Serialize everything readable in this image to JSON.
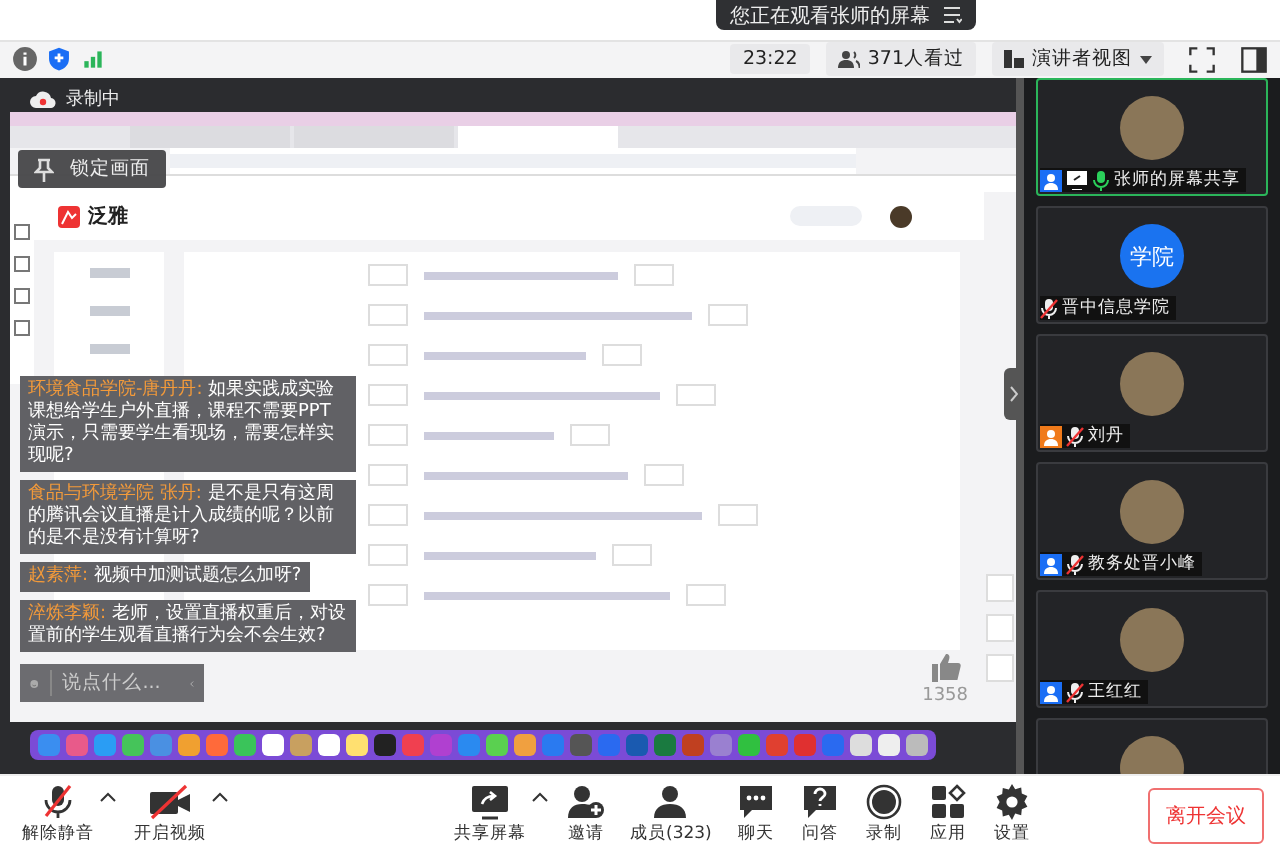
{
  "toast": {
    "text": "您正在观看张师的屏幕"
  },
  "status_bar": {
    "time": "23:22",
    "viewers": "371人看过",
    "view_mode": "演讲者视图"
  },
  "recording": {
    "label": "录制中"
  },
  "lock_button": {
    "label": "锁定画面"
  },
  "shared_screen": {
    "app_name": "泛雅",
    "likes": "1358"
  },
  "chat": {
    "messages": [
      {
        "sender": "环境食品学院-唐丹丹:",
        "text": "如果实践成实验课想给学生户外直播，课程不需要PPT演示，只需要学生看现场，需要怎样实现呢?"
      },
      {
        "sender": "食品与环境学院 张丹:",
        "text": "是不是只有这周的腾讯会议直播是计入成绩的呢？以前的是不是没有计算呀?"
      },
      {
        "sender": "赵素萍:",
        "text": "视频中加测试题怎么加呀?"
      },
      {
        "sender": "淬炼李颖:",
        "text": "老师，设置直播权重后，对设置前的学生观看直播行为会不会生效?"
      }
    ],
    "placeholder": "说点什么..."
  },
  "participants": [
    {
      "name": "张师的屏幕共享",
      "color": "#1a6ef5",
      "sharing": true,
      "muted": false,
      "active": true
    },
    {
      "name": "晋中信息学院",
      "avatar_text": "学院",
      "sharing": false,
      "muted": true,
      "active": false
    },
    {
      "name": "刘丹",
      "color": "#f07a1a",
      "sharing": false,
      "muted": true,
      "active": false
    },
    {
      "name": "教务处晋小峰",
      "color": "#1a6ef5",
      "sharing": false,
      "muted": true,
      "active": false
    },
    {
      "name": "王红红",
      "color": "#1a6ef5",
      "sharing": false,
      "muted": true,
      "active": false
    }
  ],
  "toolbar": [
    {
      "kind": "mic",
      "label": "解除静音",
      "off": true,
      "caret": true
    },
    {
      "kind": "video",
      "label": "开启视频",
      "off": true,
      "caret": true
    },
    {
      "kind": "share",
      "label": "共享屏幕",
      "caret": true
    },
    {
      "kind": "invite",
      "label": "邀请"
    },
    {
      "kind": "members",
      "label": "成员(323)"
    },
    {
      "kind": "chat",
      "label": "聊天"
    },
    {
      "kind": "qa",
      "label": "问答"
    },
    {
      "kind": "record",
      "label": "录制"
    },
    {
      "kind": "apps",
      "label": "应用"
    },
    {
      "kind": "settings",
      "label": "设置"
    }
  ],
  "leave_button": "离开会议"
}
